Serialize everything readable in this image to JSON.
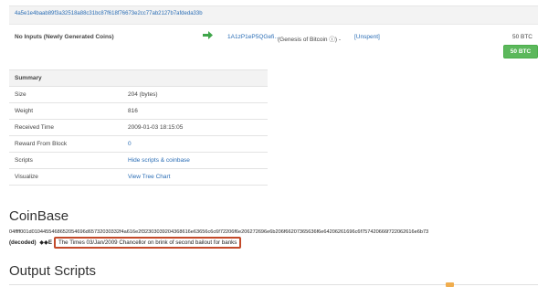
{
  "transaction": {
    "hash": "4a5e1e4baab89f3a32518a88c31bc87f618f76673e2cc77ab2127b7afdeda33b",
    "input_label": "No Inputs (Newly Generated Coins)",
    "output": {
      "address": "1A1zP1eP5QGefi…",
      "description": "(Genesis of Bitcoin ⓘ) -",
      "status": "[Unspent]",
      "value": "50 BTC"
    },
    "total_label": "50 BTC"
  },
  "icons": {
    "arrow": "arrow-right-icon",
    "arrow_color": "#3fa54a"
  },
  "summary": {
    "heading": "Summary",
    "rows": [
      {
        "key": "Size",
        "value": "204 (bytes)"
      },
      {
        "key": "Weight",
        "value": "816"
      },
      {
        "key": "Received Time",
        "value": "2009-01-03 18:15:05"
      },
      {
        "key": "Reward From Block",
        "value": "0"
      },
      {
        "key": "Scripts",
        "value": "Hide scripts & coinbase"
      },
      {
        "key": "Visualize",
        "value": "View Tree Chart"
      }
    ]
  },
  "coinbase": {
    "title": "CoinBase",
    "hex": "04ffff001d0104455468652054696d65732030332f4a616e2f32303039204368616e63656c6c6f72206f6e206272696e6b206f66207365636f6e64206261696c6f757420666f722062616e6b73",
    "decoded_label": "(decoded)",
    "decoded_junk": " ◆◆E",
    "decoded_text": "The Times 03/Jan/2009 Chancellor on brink of second bailout for banks"
  },
  "output_scripts": {
    "title": "Output Scripts"
  },
  "colors": {
    "link": "#2a6db5",
    "success": "#5cb85c",
    "highlight": "#c24a2a"
  }
}
